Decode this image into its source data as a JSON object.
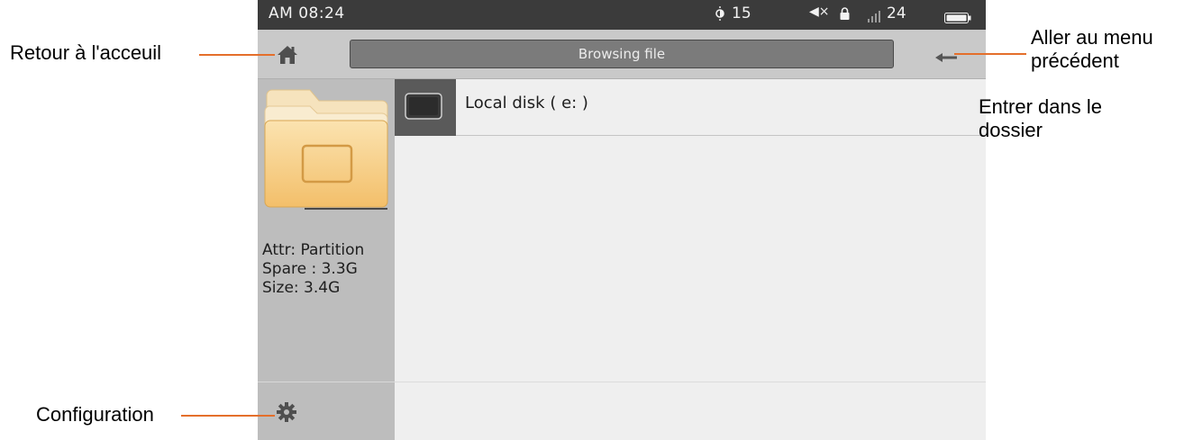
{
  "statusbar": {
    "time": "AM 08:24",
    "brightness": "15",
    "brightness_icon": "brightness-icon",
    "mute_icon": "speaker-mute-icon",
    "mute_glyph": "◀×",
    "lock_icon": "lock-icon",
    "signal_icon": "signal-bars-icon",
    "signal": "24",
    "battery_icon": "battery-icon"
  },
  "toolbar": {
    "home_icon": "home-icon",
    "title": "Browsing file",
    "back_icon": "back-arrow-icon"
  },
  "sidebar": {
    "folder_icon": "folder-tablet-icon",
    "attr": "Attr: Partition",
    "spare": "Spare : 3.3G",
    "size": "Size: 3.4G",
    "settings_icon": "gear-icon"
  },
  "file_list": [
    {
      "name": "Local disk ( e: )",
      "icon": "tablet-icon"
    }
  ],
  "annotations": {
    "home": "Retour à l'acceuil",
    "back_line1": "Aller au menu",
    "back_line2": "précédent",
    "enter_line1": "Entrer dans le",
    "enter_line2": "dossier",
    "settings": "Configuration"
  },
  "colors": {
    "statusbar_bg": "#3b3b3b",
    "toolbar_bg": "#c9c9c9",
    "title_box_bg": "#7b7b7b",
    "sidebar_bg": "#bdbdbd",
    "content_bg": "#efefef",
    "folder": "#f7cf86",
    "leader_line": "#e46f2b"
  }
}
